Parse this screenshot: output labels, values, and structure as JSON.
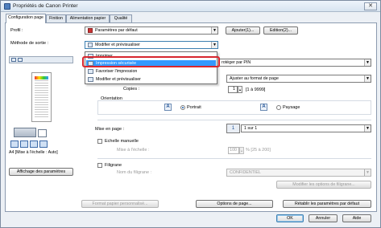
{
  "window": {
    "title": "Propriétés de Canon Printer",
    "close": "✕"
  },
  "tabs": [
    "Configuration page",
    "Finition",
    "Alimentation papier",
    "Qualité"
  ],
  "profile": {
    "label": "Profil :",
    "value": "Paramètres par défaut",
    "add": "Ajouter(1)...",
    "edit": "Edition(2)..."
  },
  "output": {
    "label": "Méthode de sortie :",
    "value": "Modifier et prévisualiser"
  },
  "dropdown": {
    "items": [
      "Imprimer",
      "Impression sécurisée",
      "Favoriser l'impression",
      "Modifier et prévisualiser"
    ],
    "selected_index": 1
  },
  "right": {
    "secure_combo": "rotéger par PIN",
    "size_combo": "Ajuster au format de page",
    "copies_label": "Copies :",
    "copies_value": "1",
    "copies_range": "[1 à 9999]",
    "orientation_label": "Orientation",
    "portrait": "Portrait",
    "paysage": "Paysage",
    "layout_label": "Mise en page :",
    "layout_value": "1 sur 1",
    "scale_label": "Echelle manuelle",
    "scale_sub": "Mise à l'échelle :",
    "scale_value": "100",
    "scale_range": "% [25 à 200]",
    "watermark_label": "Filigrane",
    "watermark_sub": "Nom du filigrane :",
    "watermark_value": "CONFIDENTIEL",
    "watermark_btn": "Modifier les options de filigrane..."
  },
  "left": {
    "preview_caption": "A4 [Mise à l'échelle : Auto]",
    "view_settings": "Affichage des paramètres"
  },
  "bottom": {
    "custom_paper": "Format papier personnalisé...",
    "page_options": "Options de page...",
    "restore": "Rétablir les paramètres par défaut"
  },
  "footer": {
    "ok": "OK",
    "cancel": "Annuler",
    "help": "Aide"
  },
  "colors": {
    "accent": "#3399ff",
    "highlight_ring": "#d8262e"
  }
}
